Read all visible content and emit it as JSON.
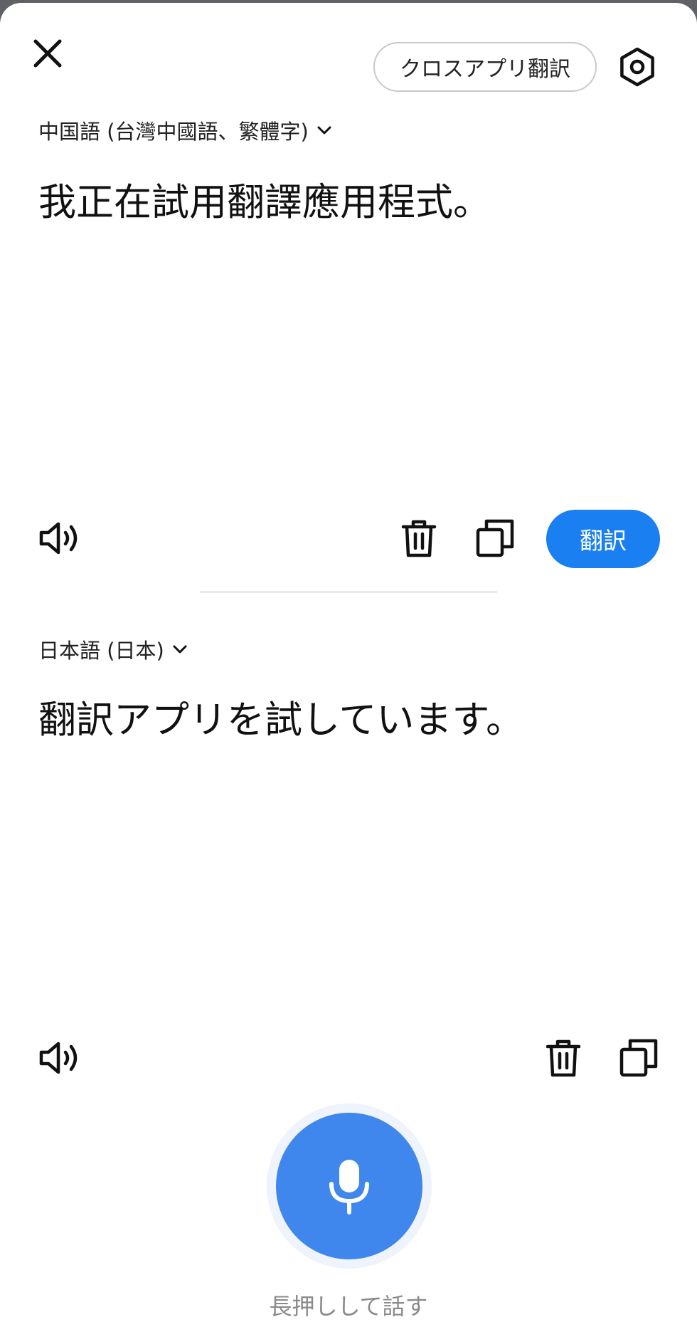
{
  "header": {
    "cross_app_label": "クロスアプリ翻訳",
    "close_icon": "close-icon",
    "settings_icon": "hexagon-settings-icon"
  },
  "source": {
    "language": "中国語 (台灣中國語、繁體字)",
    "text": "我正在試用翻譯應用程式。",
    "translate_label": "翻訳"
  },
  "target": {
    "language": "日本語 (日本)",
    "text": "翻訳アプリを試しています。"
  },
  "footer": {
    "hint": "長押しして話す"
  },
  "colors": {
    "accent": "#1a7ff0",
    "mic": "#3f86ed"
  }
}
